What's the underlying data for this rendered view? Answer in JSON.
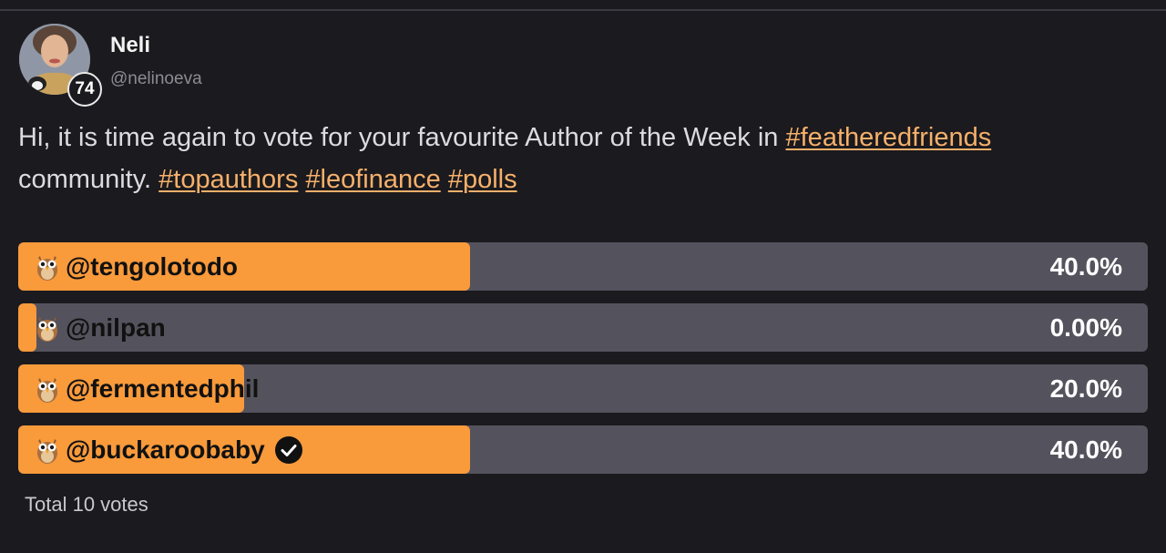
{
  "author": {
    "display_name": "Neli",
    "username": "@nelinoeva",
    "reputation": "74"
  },
  "post": {
    "text_1": "Hi, it is time again to vote for your favourite Author of the Week in ",
    "hashtag_1": "#featheredfriends",
    "text_2": " community. ",
    "hashtag_2": "#topauthors",
    "hashtag_3": "#leofinance",
    "hashtag_4": "#polls"
  },
  "poll": {
    "options": [
      {
        "label": "@tengolotodo",
        "percent_text": "40.0%",
        "percent": 40.0,
        "voted": false,
        "icon": "owl-emoji"
      },
      {
        "label": "@nilpan",
        "percent_text": "0.00%",
        "percent": 0.0,
        "voted": false,
        "icon": "owl-emoji"
      },
      {
        "label": "@fermentedphil",
        "percent_text": "20.0%",
        "percent": 20.0,
        "voted": false,
        "icon": "owl-emoji"
      },
      {
        "label": "@buckaroobaby",
        "percent_text": "40.0%",
        "percent": 40.0,
        "voted": true,
        "icon": "owl-emoji"
      }
    ],
    "total": "Total 10 votes"
  },
  "colors": {
    "background": "#1b1a1e",
    "bar_track": "#54535d",
    "bar_fill": "#f99a3b",
    "hashtag": "#f6b06b",
    "text": "#dcdbe0",
    "muted": "#8d8c93"
  }
}
